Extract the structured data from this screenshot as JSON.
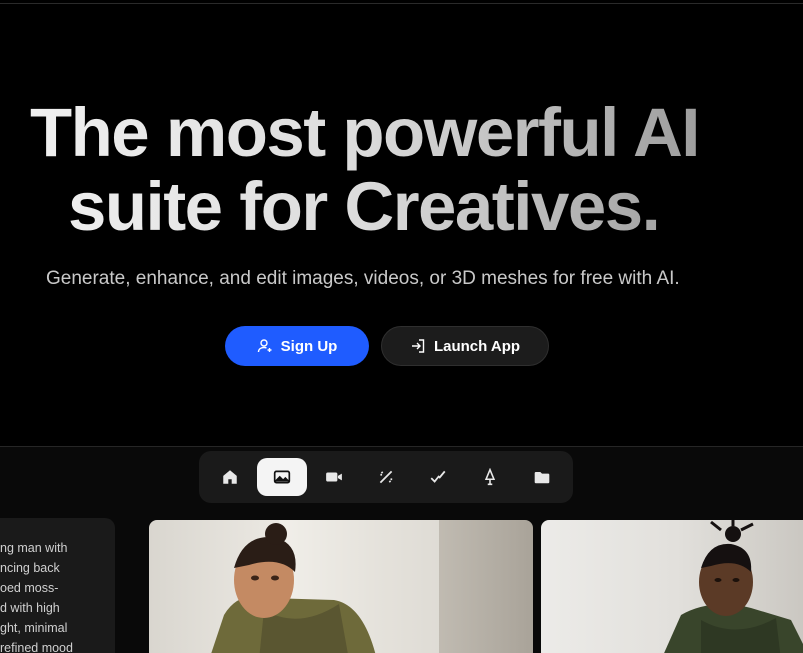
{
  "hero": {
    "title_line1": "The most powerful AI",
    "title_line2": "suite for Creatives.",
    "subtitle": "Generate, enhance, and edit images, videos, or 3D meshes for free with AI."
  },
  "buttons": {
    "signup_label": "Sign Up",
    "signup_icon": "user-plus-icon",
    "launch_label": "Launch App",
    "launch_icon": "sign-in-arrow-icon"
  },
  "toolbar": {
    "items": [
      {
        "name": "home",
        "icon": "home-icon",
        "active": false
      },
      {
        "name": "image",
        "icon": "image-icon",
        "active": true
      },
      {
        "name": "video",
        "icon": "video-camera-icon",
        "active": false
      },
      {
        "name": "enhance",
        "icon": "magic-wand-icon",
        "active": false
      },
      {
        "name": "edit",
        "icon": "edit-check-icon",
        "active": false
      },
      {
        "name": "3d",
        "icon": "pen-nib-icon",
        "active": false
      },
      {
        "name": "assets",
        "icon": "folder-icon",
        "active": false
      }
    ]
  },
  "prompt_panel": {
    "text": "ng man with\nncing back\noed moss-\nd with high\nght, minimal\nrefined mood"
  },
  "colors": {
    "background": "#000000",
    "accent": "#1f5cff",
    "secondary_button": "#1c1c1c",
    "toolbar_bg": "#1a1a1a"
  }
}
